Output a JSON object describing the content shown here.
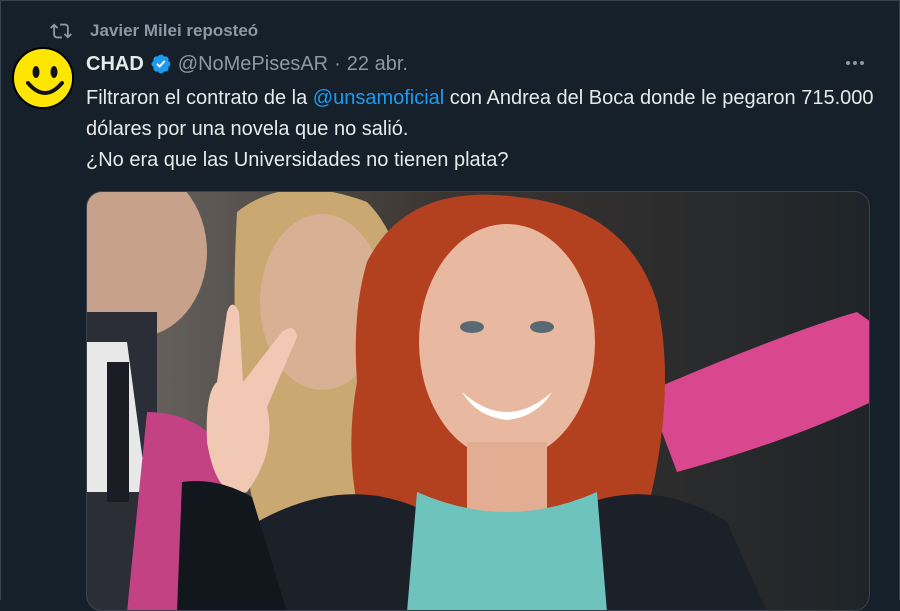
{
  "repost": {
    "icon": "repost-icon",
    "text": "Javier Milei reposteó"
  },
  "tweet": {
    "avatar_icon": "smiley-avatar",
    "display_name": "CHAD",
    "verified_icon": "verified-badge-icon",
    "handle": "@NoMePisesAR",
    "separator": "·",
    "date": "22 abr.",
    "more_icon": "more-options-icon",
    "text_part1": "Filtraron el contrato de la ",
    "mention": "@unsamoficial",
    "text_part2": " con Andrea del Boca donde le pegaron 715.000 dólares por una novela que no salió.",
    "text_line3": "¿No era que las Universidades no tienen plata?"
  },
  "colors": {
    "background": "#15202b",
    "text": "#e7e9ea",
    "secondary": "#8b98a5",
    "link": "#1d9bf0",
    "avatar": "#ffe600"
  }
}
